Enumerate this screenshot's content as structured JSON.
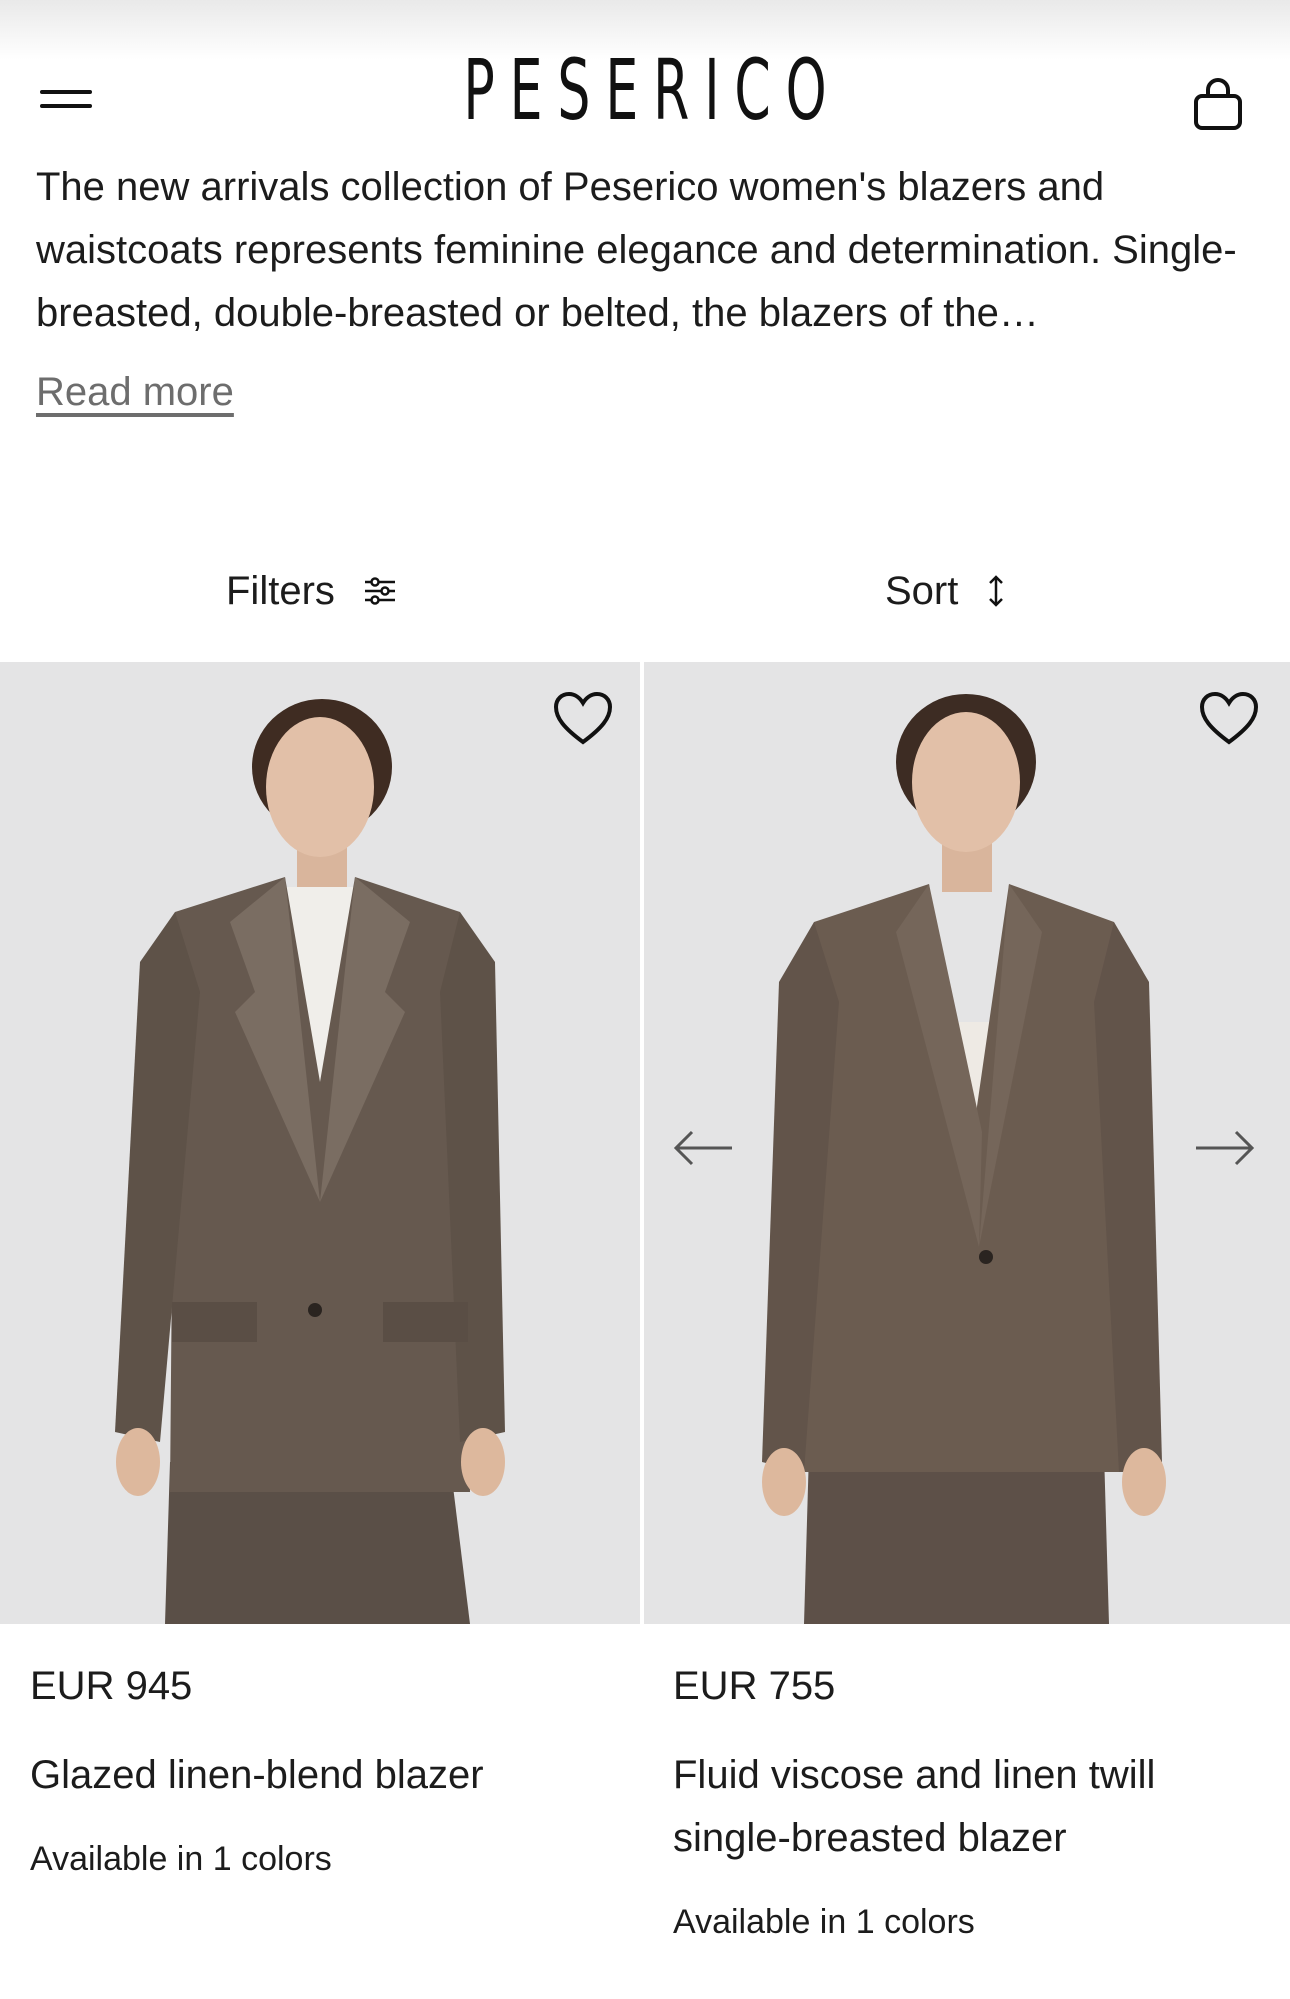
{
  "header": {
    "brand": "PESERICO",
    "menu_icon": "hamburger-menu-icon",
    "bag_icon": "shopping-bag-icon"
  },
  "intro": {
    "text": "The new arrivals collection of Peserico women's blazers and waistcoats represents feminine elegance and determination. Single-breasted, double-breasted or belted, the blazers of the…",
    "read_more": "Read more"
  },
  "toolbar": {
    "filters_label": "Filters",
    "filters_icon": "sliders-icon",
    "sort_label": "Sort",
    "sort_icon": "up-down-arrow-icon"
  },
  "products": [
    {
      "price": "EUR 945",
      "name": "Glazed linen-blend blazer",
      "availability": "Available in 1 colors",
      "image": "woman in glossy brown double-breasted blazer with striped shirt",
      "wishlist_icon": "heart-icon"
    },
    {
      "price": "EUR 755",
      "name": "Fluid viscose and linen twill single-breasted blazer",
      "availability": "Available in 1 colors",
      "image": "woman in brown shawl-collar single-breasted blazer",
      "wishlist_icon": "heart-icon",
      "carousel_icons": [
        "arrow-left-icon",
        "arrow-right-icon"
      ]
    }
  ],
  "colors": {
    "background": "#ffffff",
    "text": "#1c1c1c",
    "muted": "#6d6d6d",
    "image_bg": "#e6e6e6",
    "blazer": "#5f544b"
  }
}
